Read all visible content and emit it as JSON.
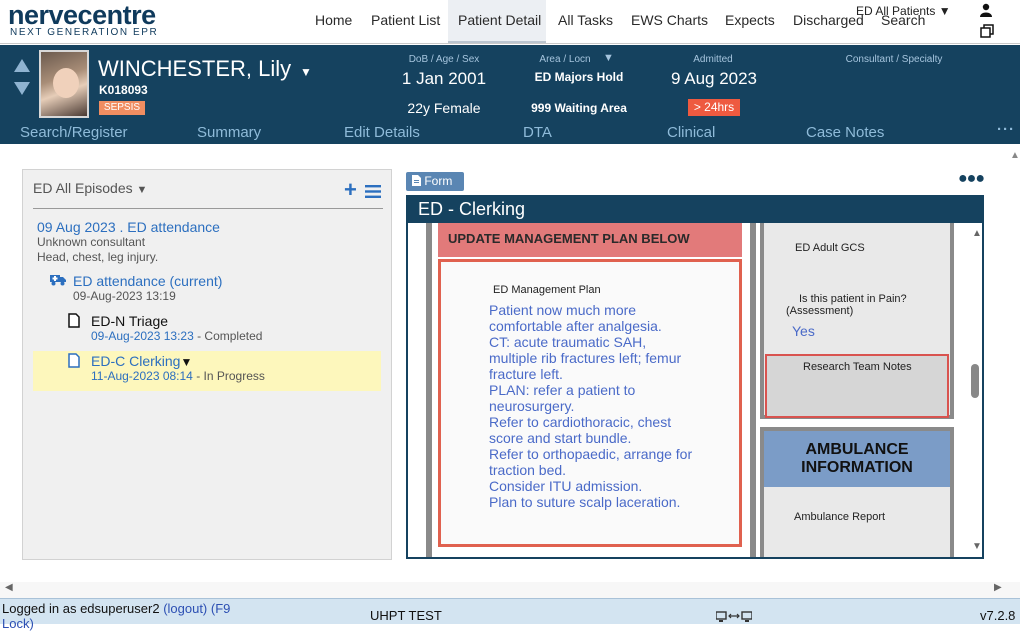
{
  "logo": {
    "main": "nervecentre",
    "sub": "NEXT GENERATION EPR"
  },
  "nav": {
    "items": [
      "Home",
      "Patient List",
      "Patient Detail",
      "All Tasks",
      "EWS Charts",
      "Expects",
      "Discharged",
      "Search"
    ],
    "active": "Patient Detail",
    "all_patients": "ED All Patients ▼"
  },
  "patient": {
    "name": "WINCHESTER, Lily",
    "id": "K018093",
    "alert": "SEPSIS",
    "dob_label": "DoB / Age / Sex",
    "dob": "1 Jan 2001",
    "age_sex": "22y Female",
    "area_label": "Area / Locn",
    "area": "ED Majors Hold",
    "location": "999 Waiting Area",
    "admitted_label": "Admitted",
    "admitted": "9 Aug 2023",
    "admitted_badge": "> 24hrs",
    "consultant_label": "Consultant / Specialty"
  },
  "subnav": {
    "items": [
      "Search/Register",
      "Summary",
      "Edit Details",
      "DTA",
      "Clinical",
      "Case Notes"
    ],
    "more": "···"
  },
  "episodes": {
    "header": "ED All Episodes",
    "episode": {
      "title": "09 Aug 2023 . ED attendance",
      "consultant": "Unknown consultant",
      "complaint": "Head, chest, leg injury."
    },
    "attendance": {
      "title": "ED attendance (current)",
      "date": "09-Aug-2023 13:19"
    },
    "triage": {
      "title": "ED-N Triage",
      "date": "09-Aug-2023 13:23",
      "status": " - Completed"
    },
    "clerking": {
      "title": "ED-C Clerking",
      "date": "11-Aug-2023 08:14",
      "status": " - In Progress"
    }
  },
  "form": {
    "tab_label": "Form",
    "title": "ED - Clerking",
    "mgmt_header": "UPDATE MANAGEMENT PLAN BELOW",
    "mgmt_label": "ED Management Plan",
    "mgmt_lines": [
      "Patient now much more",
      "comfortable after analgesia.",
      "CT: acute traumatic SAH,",
      "multiple rib fractures left; femur",
      "fracture left.",
      "PLAN: refer a patient to",
      "neurosurgery.",
      "Refer to cardiothoracic, chest",
      "score and start bundle.",
      "Refer to orthopaedic, arrange for",
      "traction bed.",
      "Consider ITU admission.",
      "Plan to suture scalp laceration."
    ],
    "gcs_label": "ED Adult GCS",
    "pain_question": "Is this patient in Pain?",
    "pain_sub": "(Assessment)",
    "pain_answer": "Yes",
    "research_label": "Research Team Notes",
    "ambulance_header": "AMBULANCE INFORMATION",
    "ambulance_report": "Ambulance Report"
  },
  "status": {
    "login_prefix": "Logged in as edsuperuser2 ",
    "logout": "(logout)",
    "f9": "(F9",
    "lock": "Lock)",
    "site": "UHPT TEST",
    "version": "v7.2.8"
  },
  "colors": {
    "banner": "#15425f",
    "accent": "#2c6fbf",
    "sepsis": "#f08d61",
    "alert_red": "#ee5a40"
  }
}
